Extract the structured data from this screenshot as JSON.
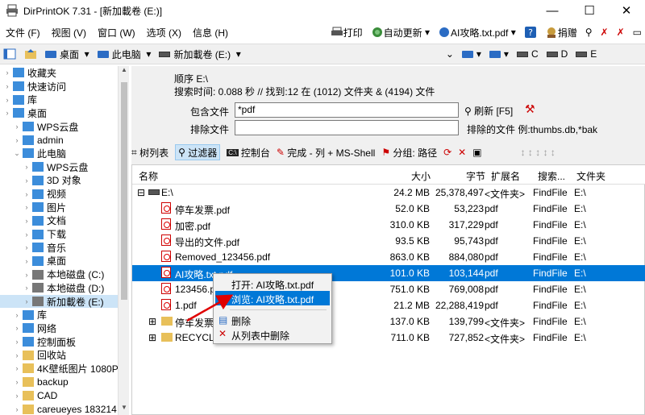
{
  "window": {
    "title": "DirPrintOK 7.31 - [新加載卷 (E:)]",
    "min": "—",
    "max": "☐",
    "close": "✕"
  },
  "menu": {
    "items": [
      "文件 (F)",
      "视图 (V)",
      "窗口 (W)",
      "选项 (X)",
      "信息 (H)"
    ],
    "print": "打印",
    "auto_update": "自动更新",
    "current_file": "AI攻略.txt.pdf",
    "donate": "捐赠"
  },
  "toolbar": {
    "desktop": "桌面",
    "this_pc": "此电脑",
    "drive": "新加載卷 (E:)",
    "drive_c": "C",
    "drive_d": "D",
    "drive_e": "E"
  },
  "tree": {
    "items": [
      {
        "label": "收藏夹",
        "indent": 0
      },
      {
        "label": "快速访问",
        "indent": 0
      },
      {
        "label": "库",
        "indent": 0
      },
      {
        "label": "桌面",
        "indent": 0
      },
      {
        "label": "WPS云盘",
        "indent": 1
      },
      {
        "label": "admin",
        "indent": 1
      },
      {
        "label": "此电脑",
        "indent": 1
      },
      {
        "label": "WPS云盘",
        "indent": 2
      },
      {
        "label": "3D 对象",
        "indent": 2
      },
      {
        "label": "视频",
        "indent": 2
      },
      {
        "label": "图片",
        "indent": 2
      },
      {
        "label": "文档",
        "indent": 2
      },
      {
        "label": "下载",
        "indent": 2
      },
      {
        "label": "音乐",
        "indent": 2
      },
      {
        "label": "桌面",
        "indent": 2
      },
      {
        "label": "本地磁盘 (C:)",
        "indent": 2
      },
      {
        "label": "本地磁盘 (D:)",
        "indent": 2
      },
      {
        "label": "新加載卷 (E:)",
        "indent": 2
      },
      {
        "label": "库",
        "indent": 1
      },
      {
        "label": "网络",
        "indent": 1
      },
      {
        "label": "控制面板",
        "indent": 1
      },
      {
        "label": "回收站",
        "indent": 1
      },
      {
        "label": "4K壁纸图片 1080P",
        "indent": 1
      },
      {
        "label": "backup",
        "indent": 1
      },
      {
        "label": "CAD",
        "indent": 1
      },
      {
        "label": "careueyes 183214",
        "indent": 1
      }
    ]
  },
  "info": {
    "order": "顺序 E:\\",
    "search": "搜索时间: 0.088 秒 // 找到:12 在 (1012) 文件夹 & (4194) 文件"
  },
  "filter": {
    "include_label": "包含文件",
    "include_value": "*pdf",
    "refresh": "刷新 [F5]",
    "exclude_label": "排除文件",
    "exclude_value": "",
    "exclude_example": "排除的文件 例:thumbs.db,*bak"
  },
  "tabs": {
    "tree_list": "树列表",
    "filter": "过滤器",
    "console": "控制台",
    "complete": "完成 - 列 + MS-Shell",
    "group": "分组: 路径"
  },
  "columns": {
    "name": "名称",
    "size": "大小",
    "bytes": "字节",
    "ext": "扩展名",
    "search": "搜索...",
    "folder": "文件夹"
  },
  "rows": [
    {
      "name": "E:\\",
      "size": "24.2 MB",
      "bytes": "25,378,497",
      "ext": "<文件夹>",
      "search": "FindFile",
      "folder": "E:\\"
    },
    {
      "name": "停车发票.pdf",
      "size": "52.0 KB",
      "bytes": "53,223",
      "ext": "pdf",
      "search": "FindFile",
      "folder": "E:\\"
    },
    {
      "name": "加密.pdf",
      "size": "310.0 KB",
      "bytes": "317,229",
      "ext": "pdf",
      "search": "FindFile",
      "folder": "E:\\"
    },
    {
      "name": "导出的文件.pdf",
      "size": "93.5 KB",
      "bytes": "95,743",
      "ext": "pdf",
      "search": "FindFile",
      "folder": "E:\\"
    },
    {
      "name": "Removed_123456.pdf",
      "size": "863.0 KB",
      "bytes": "884,080",
      "ext": "pdf",
      "search": "FindFile",
      "folder": "E:\\"
    },
    {
      "name": "AI攻略.txt.pdf",
      "size": "101.0 KB",
      "bytes": "103,144",
      "ext": "pdf",
      "search": "FindFile",
      "folder": "E:\\"
    },
    {
      "name": "123456.p",
      "size": "751.0 KB",
      "bytes": "769,008",
      "ext": "pdf",
      "search": "FindFile",
      "folder": "E:\\"
    },
    {
      "name": "1.pdf",
      "size": "21.2 MB",
      "bytes": "22,288,419",
      "ext": "pdf",
      "search": "FindFile",
      "folder": "E:\\"
    },
    {
      "name": "停车发票",
      "size": "137.0 KB",
      "bytes": "139,799",
      "ext": "<文件夹>",
      "search": "FindFile",
      "folder": "E:\\"
    },
    {
      "name": "RECYCLE",
      "size": "711.0 KB",
      "bytes": "727,852",
      "ext": "<文件夹>",
      "search": "FindFile",
      "folder": "E:\\"
    }
  ],
  "context_menu": {
    "open": "打开: AI攻略.txt.pdf",
    "browse": "浏览: AI攻略.txt.pdf",
    "delete": "删除",
    "remove": "从列表中删除"
  },
  "colors": {
    "selection": "#0078d7",
    "accent": "#2b6cc4",
    "pdf": "#cc0000"
  }
}
